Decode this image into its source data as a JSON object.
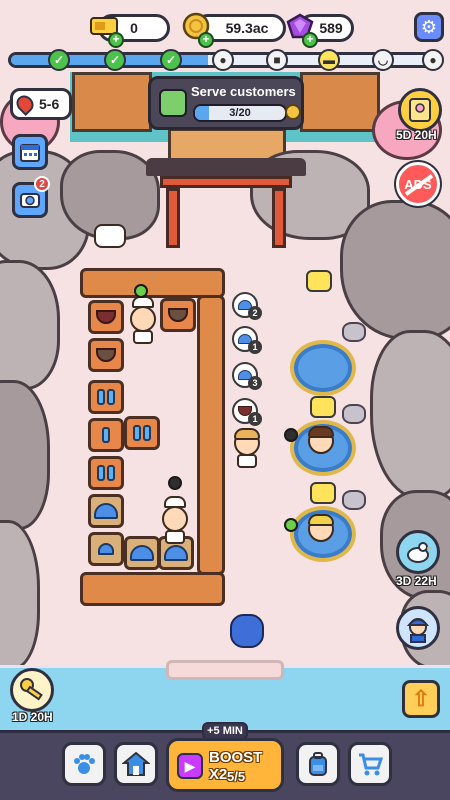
{
  "hud": {
    "tickets": "0",
    "coins": "59.3ac",
    "gems": "589"
  },
  "progress": {
    "fill_fraction": 0.46
  },
  "quest": {
    "title": "Serve customers",
    "count": "3/20",
    "fraction": 0.15
  },
  "level": {
    "label": "5-6"
  },
  "side_timers": {
    "top_right": "5D 20H",
    "right_mid": "3D 22H",
    "left_bottom": "1D 20H"
  },
  "ads": {
    "label": "ADS"
  },
  "boost": {
    "tag": "+5 MIN",
    "label": "BOOST X2",
    "count": "5/5"
  },
  "notifications": {
    "badge": "2"
  },
  "orders": [
    {
      "item": "dome",
      "count": "2"
    },
    {
      "item": "dome",
      "count": "1"
    },
    {
      "item": "dome",
      "count": "3"
    },
    {
      "item": "bowl",
      "count": "1"
    }
  ],
  "colors": {
    "progress_fill": "#5aa7ef",
    "coin": "#f5c342",
    "gem": "#a44de0",
    "boost": "#ffb53a"
  },
  "icons": {
    "tickets": "ticket-icon",
    "coins": "coin-icon",
    "gems": "gem-icon",
    "settings": "gear-icon",
    "calendar": "calendar-icon",
    "camera": "camera-icon",
    "paw": "paw-icon",
    "home": "home-icon",
    "backpack": "backpack-icon",
    "cart": "cart-icon",
    "up": "arrow-up-icon"
  }
}
